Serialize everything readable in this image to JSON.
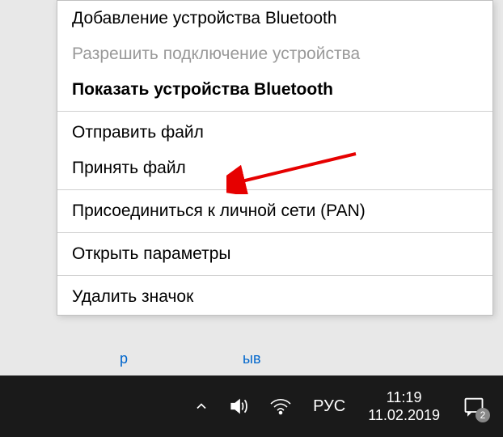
{
  "menu": {
    "items": [
      {
        "label": "Добавление устройства Bluetooth",
        "bold": false,
        "disabled": false
      },
      {
        "label": "Разрешить подключение устройства",
        "bold": false,
        "disabled": true
      },
      {
        "label": "Показать устройства Bluetooth",
        "bold": true,
        "disabled": false
      }
    ],
    "group2": [
      {
        "label": "Отправить файл"
      },
      {
        "label": "Принять файл"
      }
    ],
    "group3": [
      {
        "label": "Присоединиться к личной сети (PAN)"
      }
    ],
    "group4": [
      {
        "label": "Открыть параметры"
      }
    ],
    "group5": [
      {
        "label": "Удалить значок"
      }
    ]
  },
  "fragments": {
    "left": "р",
    "right": "ыв"
  },
  "taskbar": {
    "language": "РУС",
    "time": "11:19",
    "date": "11.02.2019",
    "notification_count": "2"
  },
  "annotation": {
    "arrow_color": "#e60000"
  }
}
